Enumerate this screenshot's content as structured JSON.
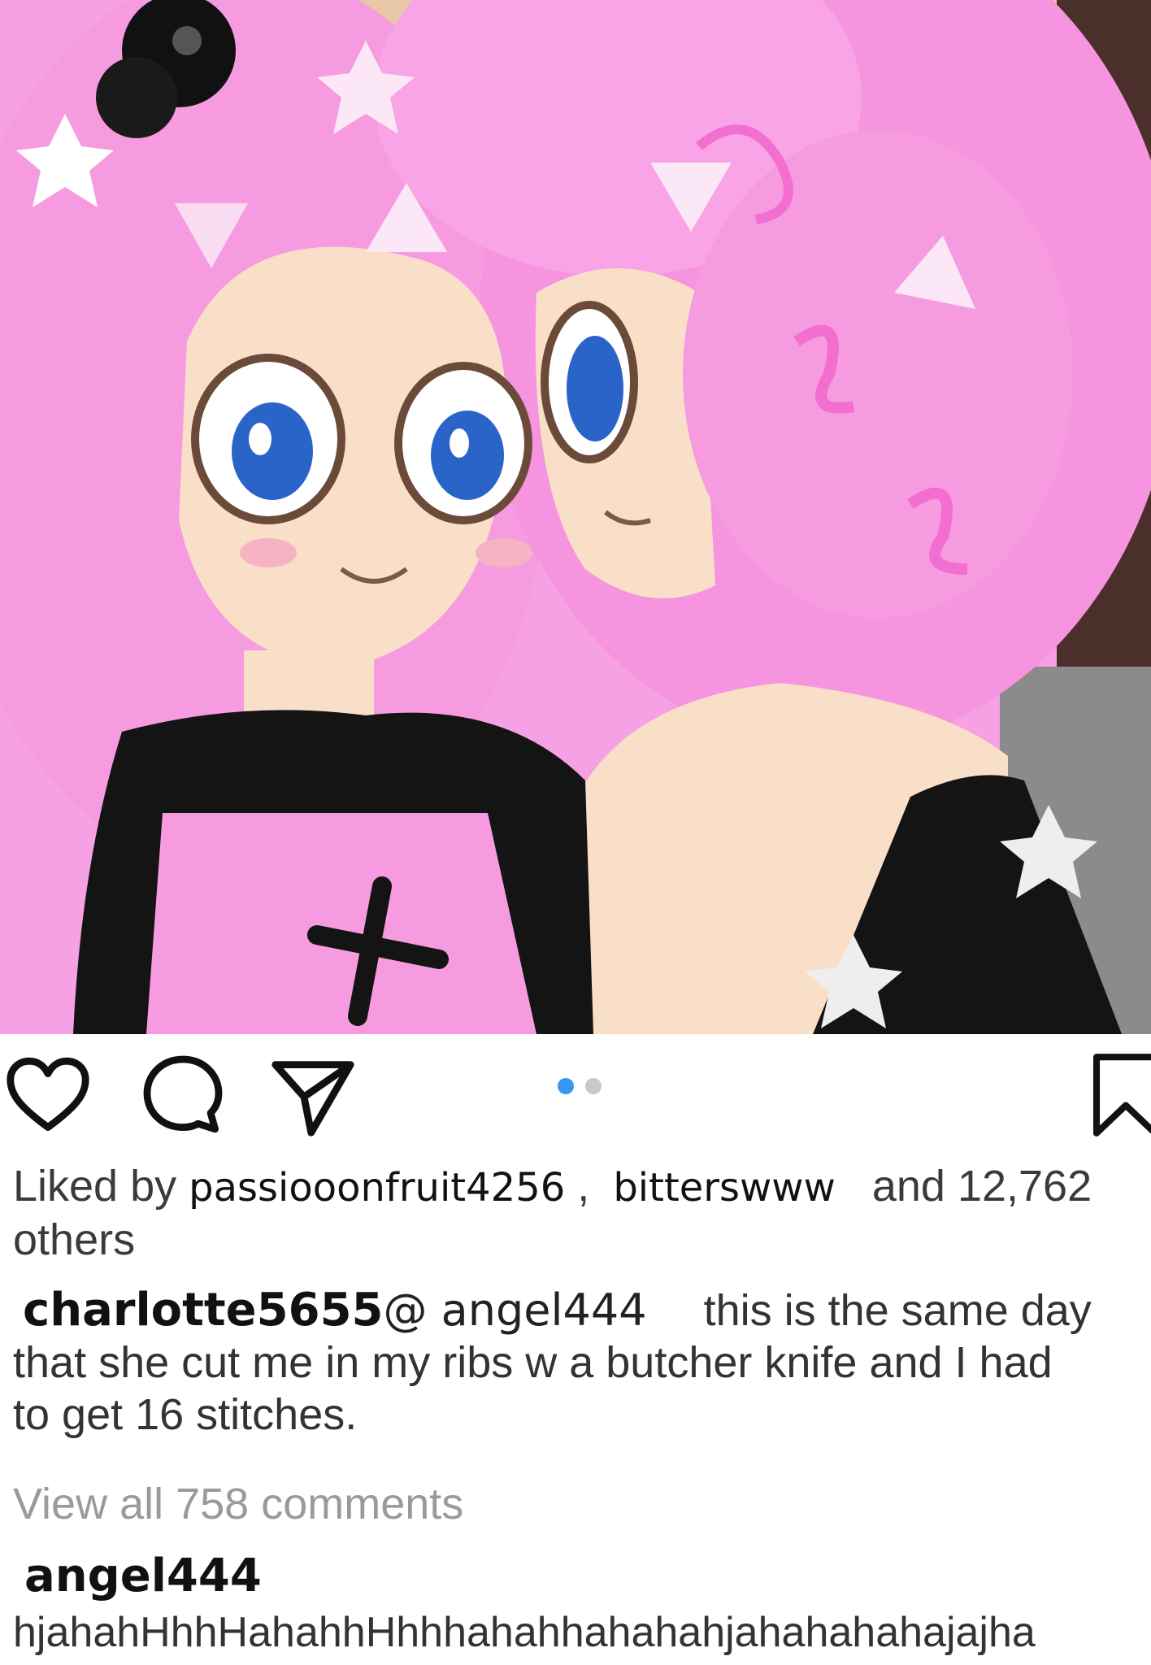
{
  "post": {
    "image_icon": "artwork-image",
    "carousel": {
      "total": 2,
      "active_index": 0
    },
    "accent_color": "#3897f0"
  },
  "actions": {
    "like_icon": "heart-icon",
    "comment_icon": "speech-bubble-icon",
    "share_icon": "paper-plane-icon",
    "save_icon": "bookmark-icon"
  },
  "likes": {
    "prefix": "Liked by",
    "user1": "passiooonfruit4256",
    "separator": ",",
    "user2": "bitterswww",
    "suffix": "and 12,762",
    "others": "others"
  },
  "caption": {
    "author": "charlotte5655",
    "mention": "@ angel444",
    "line1_text": "this is the same day",
    "line2_text": "that she cut me in my ribs w a butcher knife and I had",
    "line3_text": "to get 16 stitches."
  },
  "comments_link": "View all 758 comments",
  "top_comment": {
    "author": "angel444",
    "text": "hjahahHhhHahahhHhhhahahhahahahjahahahahajajha"
  }
}
